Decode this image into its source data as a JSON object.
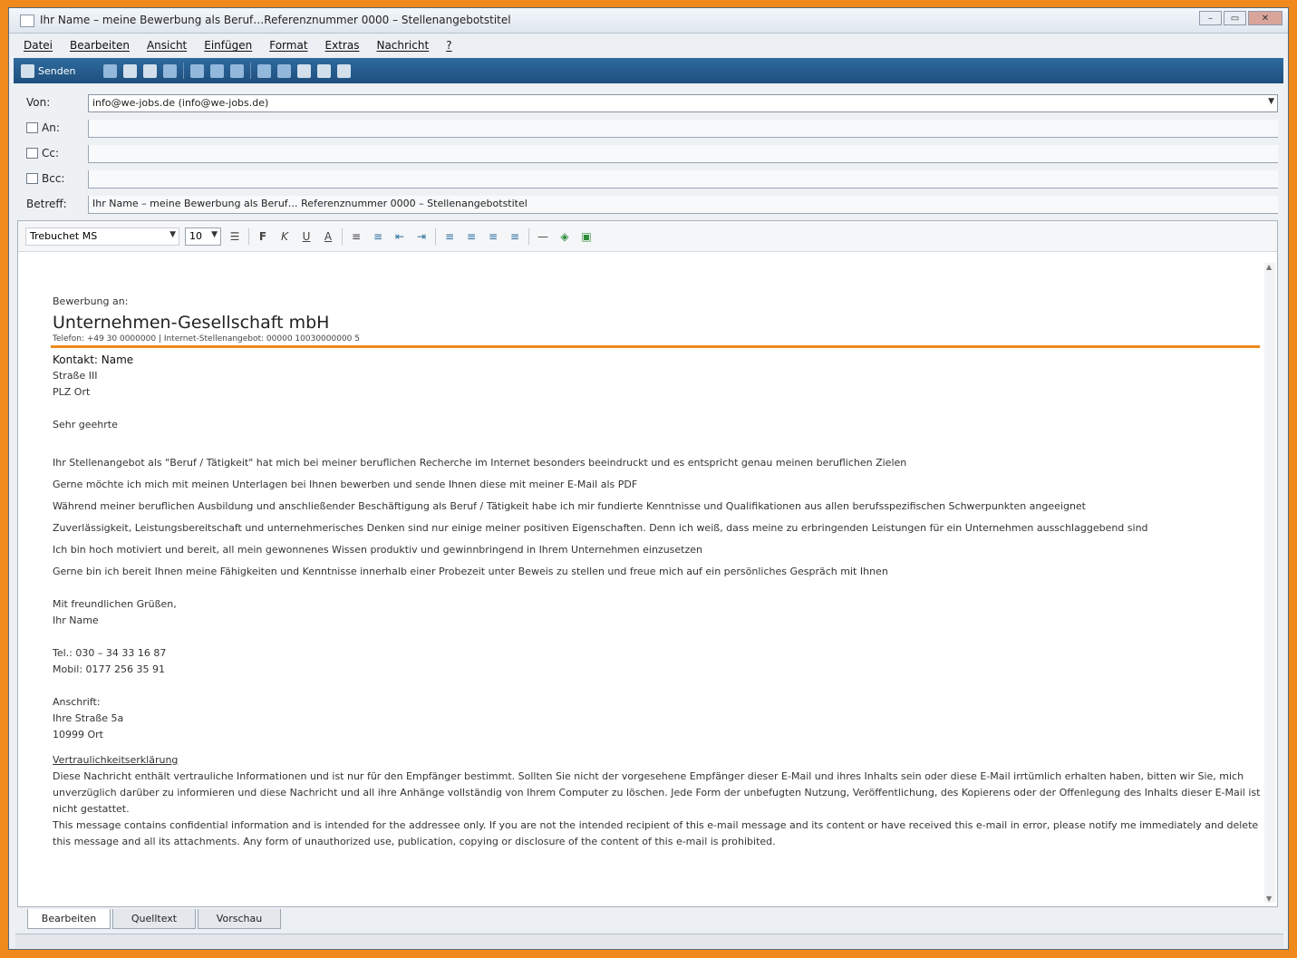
{
  "window": {
    "title": "Ihr Name – meine Bewerbung als Beruf…Referenznummer 0000 – Stellenangebotstitel",
    "controls": {
      "minimize": "–",
      "maximize": "▭",
      "close": "✕"
    }
  },
  "menubar": {
    "items": [
      "Datei",
      "Bearbeiten",
      "Ansicht",
      "Einfügen",
      "Format",
      "Extras",
      "Nachricht",
      "?"
    ]
  },
  "toolbar": {
    "send_label": "Senden"
  },
  "header": {
    "von_label": "Von:",
    "von_value": "info@we-jobs.de   (info@we-jobs.de)",
    "an_label": "An:",
    "an_value": "",
    "cc_label": "Cc:",
    "cc_value": "",
    "bcc_label": "Bcc:",
    "bcc_value": "",
    "betreff_label": "Betreff:",
    "betreff_value": "Ihr Name – meine Bewerbung als Beruf… Referenznummer 0000 – Stellenangebotstitel"
  },
  "format_toolbar": {
    "font": "Trebuchet MS",
    "size": "10"
  },
  "email": {
    "intro": "Bewerbung an:",
    "company": "Unternehmen-Gesellschaft mbH",
    "company_sub": "Telefon: +49 30 0000000 | Internet-Stellenangebot: 00000 10030000000 5",
    "contact_name": "Kontakt: Name",
    "street": "Straße III",
    "city": "PLZ Ort",
    "salutation": "Sehr geehrte",
    "p1": "Ihr Stellenangebot als \"Beruf / Tätigkeit\" hat mich bei meiner beruflichen Recherche im Internet besonders beeindruckt und es entspricht genau meinen beruflichen Zielen",
    "p2": "Gerne möchte ich mich mit meinen Unterlagen bei Ihnen bewerben und sende Ihnen diese mit meiner E-Mail als PDF",
    "p3": "Während meiner beruflichen Ausbildung und anschließender Beschäftigung als Beruf / Tätigkeit habe ich mir fundierte Kenntnisse und Qualifikationen aus allen berufsspezifischen Schwerpunkten angeeignet",
    "p4": "Zuverlässigkeit, Leistungsbereitschaft und unternehmerisches Denken sind nur einige meiner positiven Eigenschaften. Denn ich weiß, dass meine zu erbringenden Leistungen für ein Unternehmen ausschlaggebend sind",
    "p5": "Ich bin hoch motiviert und bereit, all mein gewonnenes Wissen produktiv und gewinnbringend in Ihrem Unternehmen einzusetzen",
    "p6": "Gerne bin ich bereit Ihnen meine Fähigkeiten und Kenntnisse innerhalb einer Probezeit unter Beweis zu stellen und freue mich auf ein persönliches Gespräch mit Ihnen",
    "closing": "Mit freundlichen Grüßen,",
    "closing_name": "Ihr Name",
    "tel": "Tel.: 030 – 34 33 16 87",
    "mobil": "Mobil: 0177 256 35 91",
    "anschrift_label": "Anschrift:",
    "anschrift_street": "Ihre Straße 5a",
    "anschrift_city": "10999 Ort",
    "disclaimer_title": "Vertraulichkeitserklärung",
    "disclaimer_de": "Diese Nachricht enthält vertrauliche Informationen und ist nur für den Empfänger bestimmt. Sollten Sie nicht der vorgesehene Empfänger dieser E-Mail und ihres Inhalts sein oder diese E-Mail irrtümlich erhalten haben, bitten wir Sie, mich unverzüglich darüber zu informieren und diese Nachricht und all ihre Anhänge vollständig von Ihrem Computer zu löschen. Jede Form der unbefugten Nutzung, Veröffentlichung, des Kopierens oder der Offenlegung des Inhalts dieser E-Mail ist nicht gestattet.",
    "disclaimer_en": "This message contains confidential information and is intended for the addressee only. If you are not the intended recipient of this e-mail message and its content or have received this e-mail in error, please notify me immediately and delete this message and all its attachments. Any form of unauthorized use, publication, copying or disclosure of the content of this e-mail is prohibited."
  },
  "tabs": [
    "Bearbeiten",
    "Quelltext",
    "Vorschau"
  ],
  "colors": {
    "frame": "#f08a1c",
    "toolbar": "#1e4f7d",
    "accent_rule": "#f08a1c"
  }
}
